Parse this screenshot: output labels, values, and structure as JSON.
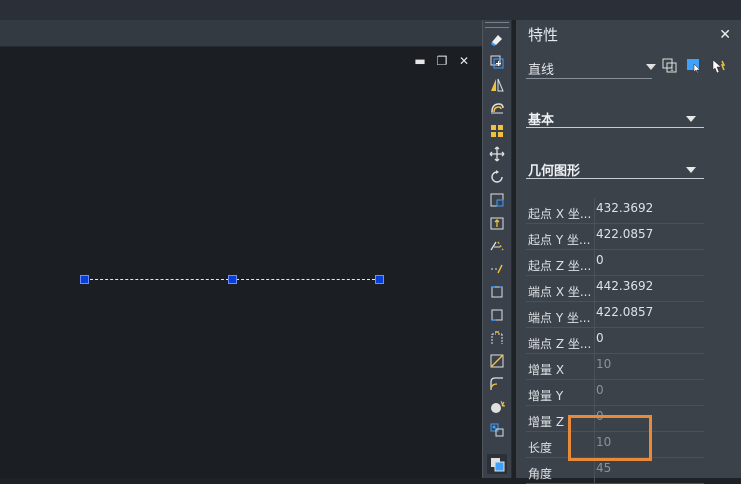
{
  "window_controls": {
    "minimize": "▬",
    "restore": "❐",
    "close": "✕"
  },
  "panel": {
    "title": "特性",
    "close": "✕",
    "selection": "直线",
    "sections": {
      "basic": "基本",
      "geometry": "几何图形"
    },
    "rows": [
      {
        "key": "起点 X 坐...",
        "value": "432.3692",
        "dim": false
      },
      {
        "key": "起点 Y 坐...",
        "value": "422.0857",
        "dim": false
      },
      {
        "key": "起点 Z 坐...",
        "value": "0",
        "dim": false
      },
      {
        "key": "端点 X 坐...",
        "value": "442.3692",
        "dim": false
      },
      {
        "key": "端点 Y 坐...",
        "value": "422.0857",
        "dim": false
      },
      {
        "key": "端点 Z 坐...",
        "value": "0",
        "dim": false
      },
      {
        "key": "增量 X",
        "value": "10",
        "dim": true
      },
      {
        "key": "增量 Y",
        "value": "0",
        "dim": true
      },
      {
        "key": "增量 Z",
        "value": "0",
        "dim": true
      },
      {
        "key": "长度",
        "value": "10",
        "dim": true
      },
      {
        "key": "角度",
        "value": "45",
        "dim": true
      }
    ]
  },
  "colors": {
    "grip": "#0a3fd6",
    "highlight": "#e88a3a",
    "panel_bg": "#3b4249",
    "canvas_bg": "#1b1e23"
  },
  "toolbar_icons": [
    "erase-icon",
    "copy-icon",
    "mirror-icon",
    "offset-icon",
    "array-icon",
    "move-icon",
    "rotate-icon",
    "scale-icon",
    "stretch-icon",
    "trim-icon",
    "extend-icon",
    "break-icon",
    "break-at-point-icon",
    "join-icon",
    "chamfer-icon",
    "fillet-icon",
    "blend-icon",
    "explode-icon",
    "properties-icon",
    "draw-order-icon"
  ]
}
